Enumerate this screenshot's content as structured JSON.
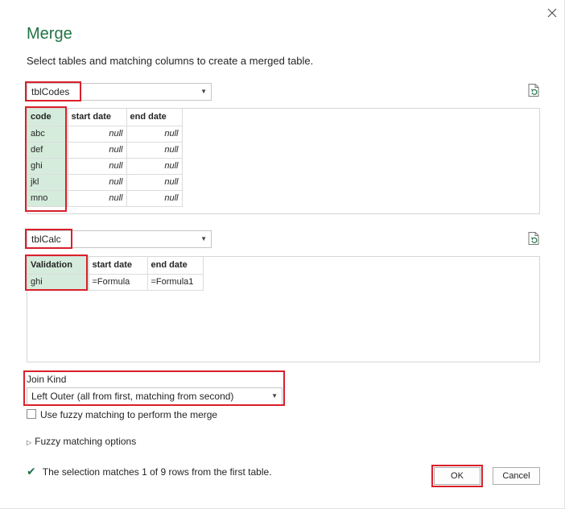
{
  "dialog": {
    "title": "Merge",
    "subtitle": "Select tables and matching columns to create a merged table."
  },
  "first_table": {
    "selected": "tblCodes",
    "columns": [
      "code",
      "start date",
      "end date"
    ],
    "rows": [
      [
        "abc",
        "null",
        "null"
      ],
      [
        "def",
        "null",
        "null"
      ],
      [
        "ghi",
        "null",
        "null"
      ],
      [
        "jkl",
        "null",
        "null"
      ],
      [
        "mno",
        "null",
        "null"
      ]
    ]
  },
  "second_table": {
    "selected": "tblCalc",
    "columns": [
      "Validation",
      "start date",
      "end date"
    ],
    "rows": [
      [
        "ghi",
        "=Formula",
        "=Formula1"
      ]
    ]
  },
  "join": {
    "label": "Join Kind",
    "selected": "Left Outer (all from first, matching from second)"
  },
  "fuzzy": {
    "checkbox_label": "Use fuzzy matching to perform the merge",
    "checked": false,
    "options_label": "Fuzzy matching options"
  },
  "status": {
    "text": "The selection matches 1 of 9 rows from the first table."
  },
  "buttons": {
    "ok": "OK",
    "cancel": "Cancel"
  },
  "colors": {
    "accent": "#217346",
    "highlight": "#d9202b",
    "selected_column": "#d5ecdc"
  },
  "icons": {
    "close": "close-icon",
    "refresh": "refresh-document-icon",
    "dropdown": "chevron-down-icon",
    "success": "checkmark-icon",
    "expand": "triangle-right-icon"
  }
}
